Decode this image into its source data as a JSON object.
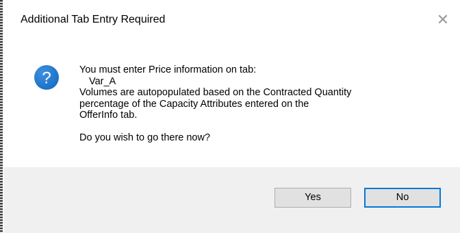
{
  "dialog": {
    "title": "Additional Tab Entry Required",
    "close_glyph": "✕",
    "icon": "question-icon",
    "icon_color": "#1a6fc4",
    "message": {
      "line1": "You must enter Price information on tab:",
      "line2": "Var_A",
      "line3": "Volumes are autopopulated based on the Contracted Quantity",
      "line4": "percentage of the Capacity Attributes entered on the",
      "line5": "OfferInfo tab.",
      "line6": "Do you wish to go there now?"
    },
    "buttons": {
      "yes_label": "Yes",
      "no_label": "No",
      "default": "No",
      "focus_color": "#0078d7"
    }
  }
}
